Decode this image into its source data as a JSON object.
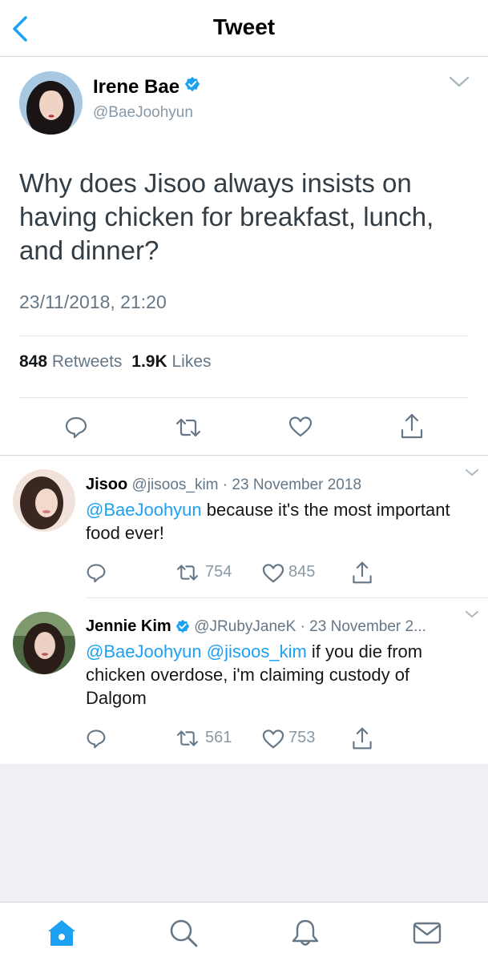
{
  "nav": {
    "title": "Tweet"
  },
  "tweet": {
    "author_name": "Irene Bae",
    "author_handle": "@BaeJoohyun",
    "text": "Why does Jisoo always insists on having chicken for breakfast, lunch, and dinner?",
    "timestamp": "23/11/2018, 21:20",
    "retweets_count": "848",
    "retweets_label": "Retweets",
    "likes_count": "1.9K",
    "likes_label": "Likes"
  },
  "replies": [
    {
      "name": "Jisoo",
      "handle": "@jisoos_kim",
      "date": "· 23 November 2018",
      "mentions": "@BaeJoohyun",
      "text": " because it's the most important food ever!",
      "retweets": "754",
      "likes": "845"
    },
    {
      "name": "Jennie Kim",
      "handle": "@JRubyJaneK",
      "date": "· 23 November 2...",
      "mentions": "@BaeJoohyun @jisoos_kim",
      "text": " if you die from chicken overdose, i'm claiming custody of Dalgom",
      "retweets": "561",
      "likes": "753"
    }
  ],
  "colors": {
    "accent": "#1da1f2",
    "icon_gray": "#657786",
    "text": "#14171a",
    "background_gray": "#efeff4"
  },
  "icons": {
    "back": "chevron-left-icon",
    "caret": "chevron-down-icon",
    "verified": "verified-badge-icon",
    "reply": "reply-icon",
    "retweet": "retweet-icon",
    "like": "heart-icon",
    "share": "share-icon",
    "home": "home-icon",
    "search": "search-icon",
    "notifications": "bell-icon",
    "messages": "mail-icon"
  }
}
